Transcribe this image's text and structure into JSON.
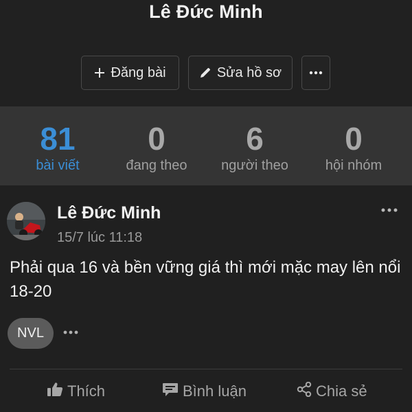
{
  "profile": {
    "name": "Lê Đức Minh",
    "post_button": "Đăng bài",
    "edit_button": "Sửa hồ sơ"
  },
  "stats": [
    {
      "value": "81",
      "label": "bài viết"
    },
    {
      "value": "0",
      "label": "đang theo"
    },
    {
      "value": "6",
      "label": "người theo"
    },
    {
      "value": "0",
      "label": "hội nhóm"
    }
  ],
  "post": {
    "author": "Lê Đức Minh",
    "time": "15/7 lúc 11:18",
    "text": "Phải qua 16 và bền vững giá thì mới mặc may lên nổi 18-20",
    "tag": "NVL",
    "actions": {
      "like": "Thích",
      "comment": "Bình luận",
      "share": "Chia sẻ"
    }
  },
  "icons": {
    "post": "plus-icon",
    "edit": "pencil-icon",
    "more": "ellipsis-icon",
    "like": "thumbs-up-icon",
    "comment": "comment-icon",
    "share": "share-icon"
  },
  "colors": {
    "background": "#202020",
    "stats_bar": "#343434",
    "accent": "#3b8ed6",
    "tag": "#5b5b5b"
  }
}
